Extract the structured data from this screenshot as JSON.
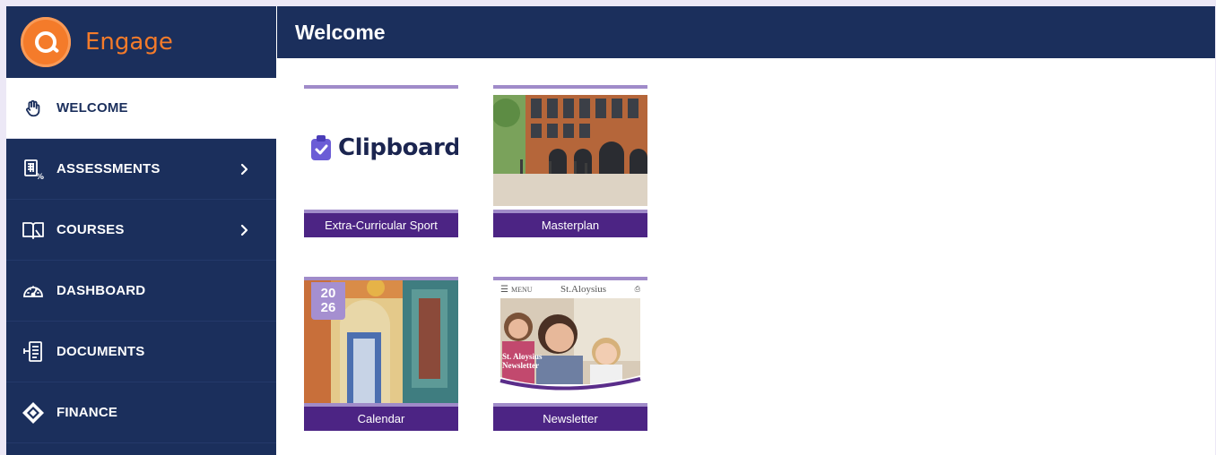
{
  "brand": {
    "name": "Engage",
    "accent": "#f47b2a"
  },
  "header": {
    "title": "Welcome",
    "bg": "#1b2f5c"
  },
  "sidebar": {
    "items": [
      {
        "label": "WELCOME",
        "icon": "hand-wave-icon",
        "active": true,
        "has_chevron": false
      },
      {
        "label": "ASSESSMENTS",
        "icon": "grade-sheet-icon",
        "active": false,
        "has_chevron": true
      },
      {
        "label": "COURSES",
        "icon": "book-icon",
        "active": false,
        "has_chevron": true
      },
      {
        "label": "DASHBOARD",
        "icon": "gauge-icon",
        "active": false,
        "has_chevron": false
      },
      {
        "label": "DOCUMENTS",
        "icon": "document-icon",
        "active": false,
        "has_chevron": false
      },
      {
        "label": "FINANCE",
        "icon": "diamond-icon",
        "active": false,
        "has_chevron": false
      }
    ]
  },
  "tiles": [
    {
      "label": "Extra-Curricular Sport",
      "media": "clipboard-logo",
      "logo_text": "Clipboard"
    },
    {
      "label": "Masterplan",
      "media": "building-photo"
    },
    {
      "label": "Calendar",
      "media": "doorway-painting",
      "badge_top": "20",
      "badge_bottom": "26"
    },
    {
      "label": "Newsletter",
      "media": "newsletter-cover",
      "masthead": "St.Aloysius",
      "menu_text": "MENU",
      "cover_text": "St. Aloysius Newsletter"
    }
  ],
  "colors": {
    "tile_label_bg": "#4c2484",
    "tile_accent": "#a08bc9",
    "nav_bg": "#1b2f5c"
  }
}
